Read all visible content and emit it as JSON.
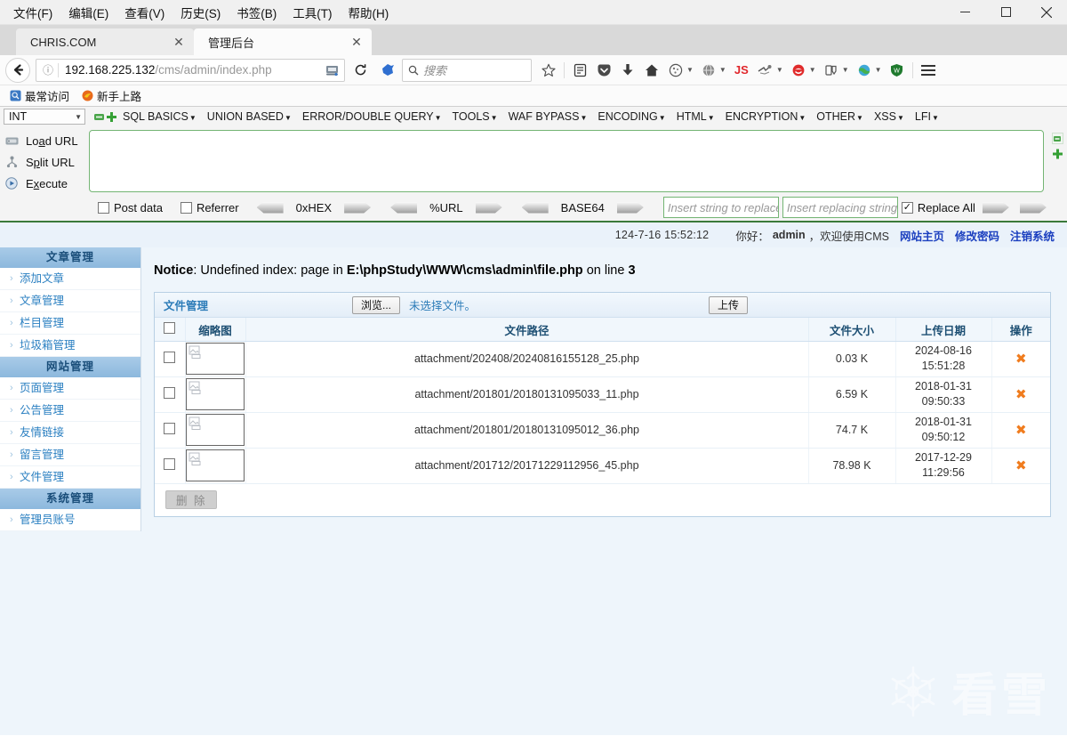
{
  "browser": {
    "menus": [
      {
        "label": "文件(F)"
      },
      {
        "label": "编辑(E)"
      },
      {
        "label": "查看(V)"
      },
      {
        "label": "历史(S)"
      },
      {
        "label": "书签(B)"
      },
      {
        "label": "工具(T)"
      },
      {
        "label": "帮助(H)"
      }
    ],
    "window_controls": {
      "minimize": "–",
      "maximize": "□",
      "close": "✕"
    },
    "tabs": [
      {
        "label": "CHRIS.COM",
        "active": false,
        "close": "✕"
      },
      {
        "label": "管理后台",
        "active": true,
        "close": "✕"
      }
    ],
    "address": {
      "host": "192.168.225.132",
      "path": "/cms/admin/index.php",
      "full": "192.168.225.132/cms/admin/index.php",
      "info_icon": "ⓘ"
    },
    "search": {
      "placeholder": "搜索"
    },
    "reload_glyph": "⟳",
    "back_glyph": "←",
    "toolbar_icons": [
      "star-icon",
      "library-icon",
      "pocket-icon",
      "download-icon",
      "home-icon",
      "cookie-icon",
      "globe-icon",
      "js-icon",
      "wappalyzer-icon",
      "hackbar-icon",
      "multi-account-icon",
      "proxy-icon",
      "wot-icon",
      "menu-icon"
    ],
    "bookmarks": [
      {
        "label": "最常访问"
      },
      {
        "label": "新手上路"
      }
    ]
  },
  "hackbar": {
    "type_select": "INT",
    "menus": [
      {
        "label": "SQL BASICS"
      },
      {
        "label": "UNION BASED"
      },
      {
        "label": "ERROR/DOUBLE QUERY"
      },
      {
        "label": "TOOLS"
      },
      {
        "label": "WAF BYPASS"
      },
      {
        "label": "ENCODING"
      },
      {
        "label": "HTML"
      },
      {
        "label": "ENCRYPTION"
      },
      {
        "label": "OTHER"
      },
      {
        "label": "XSS"
      },
      {
        "label": "LFI"
      }
    ],
    "actions": [
      {
        "label": "Load URL",
        "icon": "load-url-icon"
      },
      {
        "label": "Split URL",
        "icon": "split-url-icon"
      },
      {
        "label": "Execute",
        "icon": "execute-icon"
      }
    ],
    "url_textarea_value": "",
    "options": [
      {
        "label": "Post data",
        "checked": false
      },
      {
        "label": "Referrer",
        "checked": false
      }
    ],
    "converters": [
      {
        "label": "0xHEX"
      },
      {
        "label": "%URL"
      },
      {
        "label": "BASE64"
      }
    ],
    "replace_from_placeholder": "Insert string to replace",
    "replace_to_placeholder": "Insert replacing string",
    "replace_all_label": "Replace All",
    "replace_all_checked": true
  },
  "page": {
    "timestamp": "124-7-16 15:52:12",
    "greeting_prefix": "你好：",
    "username": "admin",
    "greeting_suffix": "，欢迎使用CMS",
    "links": [
      {
        "label": "网站主页"
      },
      {
        "label": "修改密码"
      },
      {
        "label": "注销系统"
      }
    ],
    "notice": {
      "label": "Notice",
      "text": ": Undefined index: page in ",
      "path": "E:\\phpStudy\\WWW\\cms\\admin\\file.php",
      "tail": " on line ",
      "line": "3"
    },
    "sidebar": [
      {
        "type": "header",
        "label": "文章管理"
      },
      {
        "type": "item",
        "label": "添加文章"
      },
      {
        "type": "item",
        "label": "文章管理"
      },
      {
        "type": "item",
        "label": "栏目管理"
      },
      {
        "type": "item",
        "label": "垃圾箱管理"
      },
      {
        "type": "header",
        "label": "网站管理"
      },
      {
        "type": "item",
        "label": "页面管理"
      },
      {
        "type": "item",
        "label": "公告管理"
      },
      {
        "type": "item",
        "label": "友情链接"
      },
      {
        "type": "item",
        "label": "留言管理"
      },
      {
        "type": "item",
        "label": "文件管理"
      },
      {
        "type": "header",
        "label": "系统管理"
      },
      {
        "type": "item",
        "label": "管理员账号"
      }
    ],
    "panel": {
      "title": "文件管理",
      "browse_label": "浏览...",
      "no_file_label": "未选择文件。",
      "upload_label": "上传",
      "delete_label": "删 除",
      "columns": [
        {
          "key": "checkbox",
          "label": ""
        },
        {
          "key": "thumb",
          "label": "缩略图"
        },
        {
          "key": "path",
          "label": "文件路径"
        },
        {
          "key": "size",
          "label": "文件大小"
        },
        {
          "key": "date",
          "label": "上传日期"
        },
        {
          "key": "op",
          "label": "操作"
        }
      ],
      "rows": [
        {
          "path": "attachment/202408/20240816155128_25.php",
          "size": "0.03 K",
          "date_day": "2024-08-16",
          "date_time": "15:51:28",
          "delete_glyph": "✖"
        },
        {
          "path": "attachment/201801/20180131095033_11.php",
          "size": "6.59 K",
          "date_day": "2018-01-31",
          "date_time": "09:50:33",
          "delete_glyph": "✖"
        },
        {
          "path": "attachment/201801/20180131095012_36.php",
          "size": "74.7 K",
          "date_day": "2018-01-31",
          "date_time": "09:50:12",
          "delete_glyph": "✖"
        },
        {
          "path": "attachment/201712/20171229112956_45.php",
          "size": "78.98 K",
          "date_day": "2017-12-29",
          "date_time": "11:29:56",
          "delete_glyph": "✖"
        }
      ]
    },
    "watermark": "看雪"
  },
  "colors": {
    "accent_blue": "#2c7cb8",
    "link_blue": "#1b3fbf",
    "hackbar_green": "#3a7a3a",
    "delete_orange": "#f07c1e",
    "page_bg": "#eef5fb"
  }
}
